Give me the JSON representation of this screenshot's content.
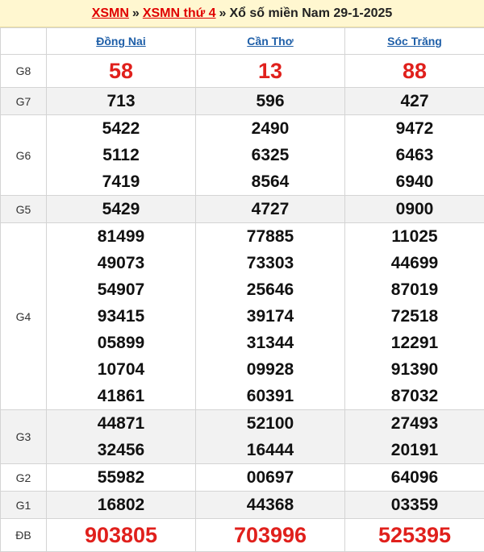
{
  "header": {
    "link1": "XSMN",
    "sep1": "»",
    "link2": "XSMN thứ 4",
    "sep2": "»",
    "title": "Xổ số miền Nam 29-1-2025"
  },
  "provinces": [
    "Đồng Nai",
    "Cần Thơ",
    "Sóc Trăng"
  ],
  "prizes": [
    {
      "label": "G8",
      "cols": [
        [
          "58"
        ],
        [
          "13"
        ],
        [
          "88"
        ]
      ]
    },
    {
      "label": "G7",
      "cols": [
        [
          "713"
        ],
        [
          "596"
        ],
        [
          "427"
        ]
      ]
    },
    {
      "label": "G6",
      "cols": [
        [
          "5422",
          "5112",
          "7419"
        ],
        [
          "2490",
          "6325",
          "8564"
        ],
        [
          "9472",
          "6463",
          "6940"
        ]
      ]
    },
    {
      "label": "G5",
      "cols": [
        [
          "5429"
        ],
        [
          "4727"
        ],
        [
          "0900"
        ]
      ]
    },
    {
      "label": "G4",
      "cols": [
        [
          "81499",
          "49073",
          "54907",
          "93415",
          "05899",
          "10704",
          "41861"
        ],
        [
          "77885",
          "73303",
          "25646",
          "39174",
          "31344",
          "09928",
          "60391"
        ],
        [
          "11025",
          "44699",
          "87019",
          "72518",
          "12291",
          "91390",
          "87032"
        ]
      ]
    },
    {
      "label": "G3",
      "cols": [
        [
          "44871",
          "32456"
        ],
        [
          "52100",
          "16444"
        ],
        [
          "27493",
          "20191"
        ]
      ]
    },
    {
      "label": "G2",
      "cols": [
        [
          "55982"
        ],
        [
          "00697"
        ],
        [
          "64096"
        ]
      ]
    },
    {
      "label": "G1",
      "cols": [
        [
          "16802"
        ],
        [
          "44368"
        ],
        [
          "03359"
        ]
      ]
    },
    {
      "label": "ĐB",
      "cols": [
        [
          "903805"
        ],
        [
          "703996"
        ],
        [
          "525395"
        ]
      ]
    }
  ],
  "colors": {
    "accent_red": "#e0201c",
    "link_blue": "#1f5fa8",
    "header_bg": "#fff7d0"
  }
}
